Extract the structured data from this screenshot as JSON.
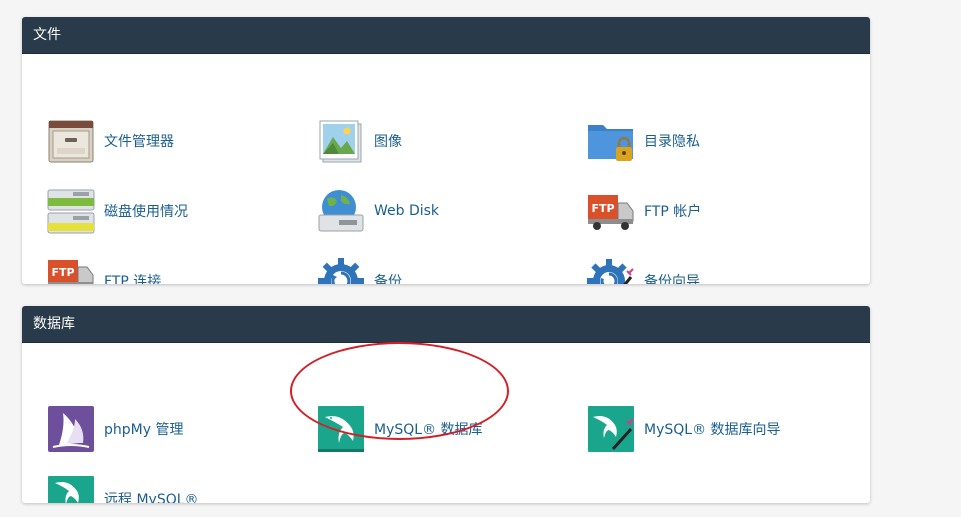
{
  "files": {
    "header": "文件",
    "items": [
      {
        "label": "文件管理器",
        "icon": "file-cabinet-icon"
      },
      {
        "label": "图像",
        "icon": "images-icon"
      },
      {
        "label": "目录隐私",
        "icon": "folder-lock-icon"
      },
      {
        "label": "磁盘使用情况",
        "icon": "disk-usage-icon"
      },
      {
        "label": "Web Disk",
        "icon": "web-disk-icon"
      },
      {
        "label": "FTP 帐户",
        "icon": "ftp-truck-icon"
      },
      {
        "label": "FTP 连接",
        "icon": "ftp-connections-icon"
      },
      {
        "label": "备份",
        "icon": "backup-gear-icon"
      },
      {
        "label": "备份向导",
        "icon": "backup-wizard-icon"
      }
    ]
  },
  "databases": {
    "header": "数据库",
    "items": [
      {
        "label": "phpMy 管理",
        "icon": "phpmyadmin-sail-icon"
      },
      {
        "label": "MySQL® 数据库",
        "icon": "mysql-dolphin-icon"
      },
      {
        "label": "MySQL® 数据库向导",
        "icon": "mysql-wizard-icon"
      },
      {
        "label": "远程 MySQL®",
        "icon": "remote-mysql-icon"
      }
    ]
  },
  "colors": {
    "header_bg": "#293a4a",
    "link": "#1b5f91",
    "highlight": "#d41f26",
    "mysql_teal": "#1aa68c"
  }
}
